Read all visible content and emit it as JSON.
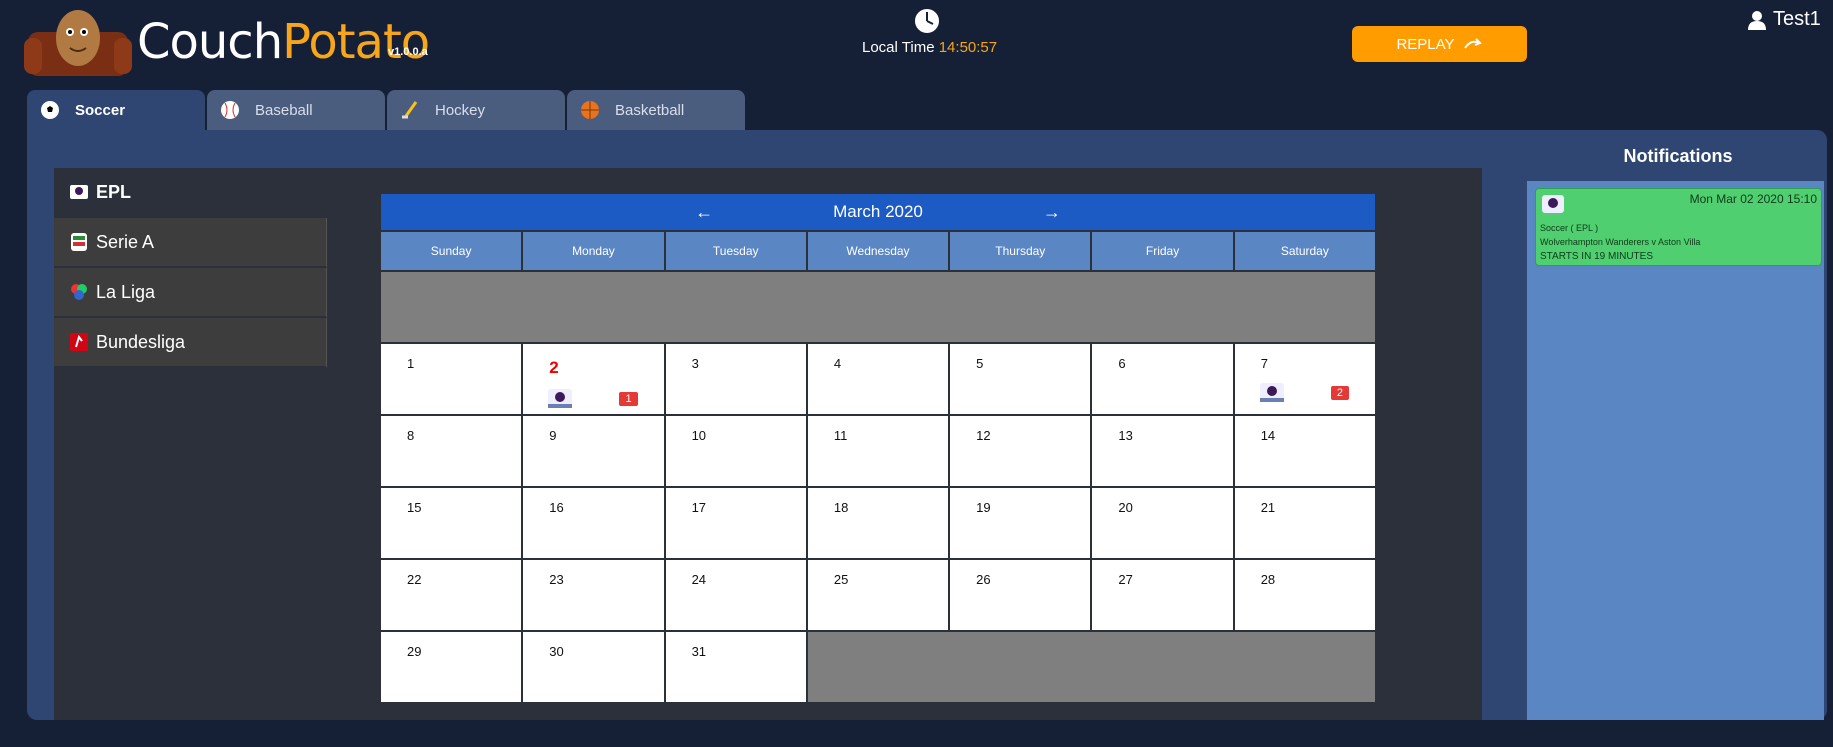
{
  "header": {
    "brand_part1": "Couch",
    "brand_part2": "Potato",
    "version": "v1.0.0.a",
    "local_time_label": "Local Time",
    "local_time_value": "14:50:57",
    "replay_label": "REPLAY",
    "user_name": "Test1"
  },
  "tabs": [
    {
      "label": "Soccer",
      "icon": "soccer-ball-icon",
      "active": true
    },
    {
      "label": "Baseball",
      "icon": "baseball-icon",
      "active": false
    },
    {
      "label": "Hockey",
      "icon": "hockey-stick-icon",
      "active": false
    },
    {
      "label": "Basketball",
      "icon": "basketball-icon",
      "active": false
    }
  ],
  "leagues": [
    {
      "label": "EPL",
      "icon": "epl-logo-icon",
      "active": true
    },
    {
      "label": "Serie A",
      "icon": "serie-a-logo-icon",
      "active": false
    },
    {
      "label": "La Liga",
      "icon": "la-liga-logo-icon",
      "active": false
    },
    {
      "label": "Bundesliga",
      "icon": "bundesliga-logo-icon",
      "active": false
    }
  ],
  "calendar": {
    "month_label": "March 2020",
    "weekdays": [
      "Sunday",
      "Monday",
      "Tuesday",
      "Wednesday",
      "Thursday",
      "Friday",
      "Saturday"
    ],
    "days": [
      {
        "day": "1"
      },
      {
        "day": "2",
        "today": true,
        "events": "1"
      },
      {
        "day": "3"
      },
      {
        "day": "4"
      },
      {
        "day": "5"
      },
      {
        "day": "6"
      },
      {
        "day": "7",
        "events": "2"
      },
      {
        "day": "8"
      },
      {
        "day": "9"
      },
      {
        "day": "10"
      },
      {
        "day": "11"
      },
      {
        "day": "12"
      },
      {
        "day": "13"
      },
      {
        "day": "14"
      },
      {
        "day": "15"
      },
      {
        "day": "16"
      },
      {
        "day": "17"
      },
      {
        "day": "18"
      },
      {
        "day": "19"
      },
      {
        "day": "20"
      },
      {
        "day": "21"
      },
      {
        "day": "22"
      },
      {
        "day": "23"
      },
      {
        "day": "24"
      },
      {
        "day": "25"
      },
      {
        "day": "26"
      },
      {
        "day": "27"
      },
      {
        "day": "28"
      },
      {
        "day": "29"
      },
      {
        "day": "30"
      },
      {
        "day": "31"
      }
    ]
  },
  "notifications": {
    "title": "Notifications",
    "items": [
      {
        "time": "Mon Mar 02 2020 15:10",
        "sport": "Soccer ( EPL )",
        "match": "Wolverhampton Wanderers v Aston Villa",
        "status": "STARTS IN 19 MINUTES"
      }
    ]
  },
  "colors": {
    "accent": "#f7a51a",
    "replay": "#ff9d00",
    "calendar_header": "#1c5ac4",
    "weekday_header": "#5b86c4",
    "event_badge": "#e53935",
    "notification": "#4fcf6f"
  }
}
